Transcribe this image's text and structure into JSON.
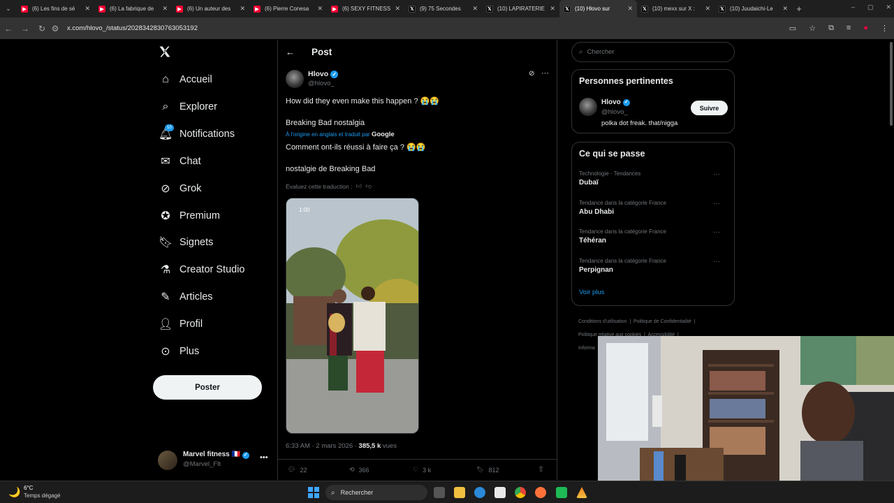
{
  "tabs": [
    {
      "title": "(6) Les fins de sé",
      "icon": "youtube-icon"
    },
    {
      "title": "(6) La fabrique de",
      "icon": "youtube-icon"
    },
    {
      "title": "(6) Un auteur des",
      "icon": "youtube-icon"
    },
    {
      "title": "(6) Pierre Conesa",
      "icon": "youtube-icon"
    },
    {
      "title": "(6) SEXY FITNESS",
      "icon": "youtube-icon"
    },
    {
      "title": "(9) 75 Secondes",
      "icon": "x-icon"
    },
    {
      "title": "(10) LAPIRATERIE",
      "icon": "x-icon"
    },
    {
      "title": "(10) Hlovo sur",
      "icon": "x-icon",
      "active": true
    },
    {
      "title": "(10) mexx sur X :",
      "icon": "x-icon"
    },
    {
      "title": "(10) Juudaichi·Le",
      "icon": "x-icon"
    }
  ],
  "address": {
    "url": "x.com/hlovo_/status/2028342830763053192"
  },
  "sidebar": {
    "items": [
      {
        "label": "Accueil",
        "icon": "home-icon"
      },
      {
        "label": "Explorer",
        "icon": "search-icon"
      },
      {
        "label": "Notifications",
        "icon": "bell-icon",
        "badge": "10"
      },
      {
        "label": "Chat",
        "icon": "mail-icon"
      },
      {
        "label": "Grok",
        "icon": "grok-icon"
      },
      {
        "label": "Premium",
        "icon": "verified-icon"
      },
      {
        "label": "Signets",
        "icon": "bookmark-icon"
      },
      {
        "label": "Creator Studio",
        "icon": "flask-icon"
      },
      {
        "label": "Articles",
        "icon": "article-icon"
      },
      {
        "label": "Profil",
        "icon": "person-icon"
      },
      {
        "label": "Plus",
        "icon": "more-circle-icon"
      }
    ],
    "post_button": "Poster",
    "account": {
      "name": "Marvel fitness",
      "flag": "🇫🇷",
      "handle": "@Marvel_Flt"
    }
  },
  "post": {
    "header": "Post",
    "author": {
      "name": "Hlovo",
      "handle": "@hlovo_"
    },
    "text_original": "How did they even make this happen ? 😭😭",
    "text_original_2": "Breaking Bad nostalgia",
    "translation_note": "À l'origine en anglais et traduit par",
    "translation_provider": "Google",
    "text_translated": "Comment ont-ils réussi à faire ça ? 😭😭",
    "text_translated_2": "nostalgie de Breaking Bad",
    "rate_translation": "Évaluez cette traduction :",
    "video_timestamp": "1:00",
    "meta_time": "6:33 AM · 2 mars 2026 · ",
    "meta_views": "385,5 k",
    "meta_views_label": " vues",
    "actions": {
      "replies": "22",
      "reposts": "366",
      "likes": "3 k",
      "bookmarks": "812"
    }
  },
  "right": {
    "search_placeholder": "Chercher",
    "relevant": {
      "title": "Personnes pertinentes",
      "name": "Hlovo",
      "handle": "@hlovo_",
      "bio": "polka dot freak. that/nigga",
      "follow": "Suivre"
    },
    "trends": {
      "title": "Ce qui se passe",
      "items": [
        {
          "category": "Technologie · Tendances",
          "name": "Dubaï"
        },
        {
          "category": "Tendance dans la catégorie France",
          "name": "Abu Dhabi"
        },
        {
          "category": "Tendance dans la catégorie France",
          "name": "Téhéran"
        },
        {
          "category": "Tendance dans la catégorie France",
          "name": "Perpignan"
        }
      ],
      "more": "Voir plus"
    },
    "footer": [
      "Conditions d'utilisation",
      "Politique de Confidentialité",
      "Politique relative aux cookies",
      "Accessibilité",
      "Informa"
    ]
  },
  "taskbar": {
    "weather_temp": "6°C",
    "weather_desc": "Temps dégagé",
    "search": "Rechercher"
  },
  "colors": {
    "accent": "#1d9bf0",
    "background": "#000000",
    "border": "#2f3336"
  }
}
